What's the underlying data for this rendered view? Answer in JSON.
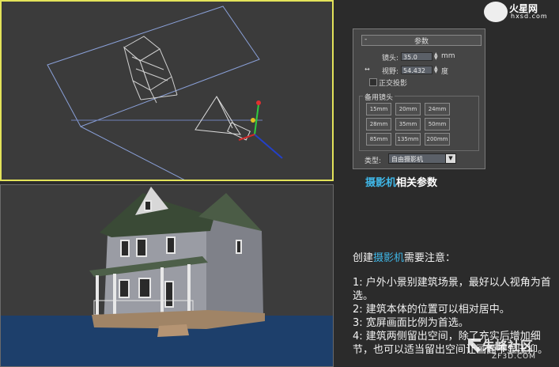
{
  "logo": {
    "site_name": "火星网",
    "site_url": "hxsd.com"
  },
  "panel": {
    "title": "参数",
    "collapse_symbol": "-",
    "lens_label": "镜头:",
    "lens_value": "35.0",
    "lens_unit": "mm",
    "fov_label": "视野:",
    "fov_value": "54.432",
    "fov_unit": "度",
    "ortho_label": "正交投影",
    "stock_lens_label": "备用镜头",
    "stock_lenses": [
      "15mm",
      "20mm",
      "24mm",
      "28mm",
      "35mm",
      "50mm",
      "85mm",
      "135mm",
      "200mm"
    ],
    "type_label": "类型:",
    "type_value": "自由摄影机"
  },
  "caption": {
    "highlight": "摄影机",
    "rest": "相关参数"
  },
  "notes": {
    "heading_prefix": "创建",
    "heading_highlight": "摄影机",
    "heading_suffix": "需要注意：",
    "items": [
      "1: 户外小景别建筑场景，最好以人视角为首选。",
      "2: 建筑本体的位置可以相对居中。",
      "3: 宽屏画面比例为首选。",
      "4: 建筑两侧留出空间，除了充实后增加细节，也可以适当留出空间让画面不显压抑。"
    ]
  },
  "watermark": {
    "text": "朱峰社区",
    "url": "ZF3D.COM"
  },
  "colors": {
    "accent": "#3fb6e6",
    "viewport_active_border": "#e3e35a",
    "floor": "#1d3f6b"
  }
}
